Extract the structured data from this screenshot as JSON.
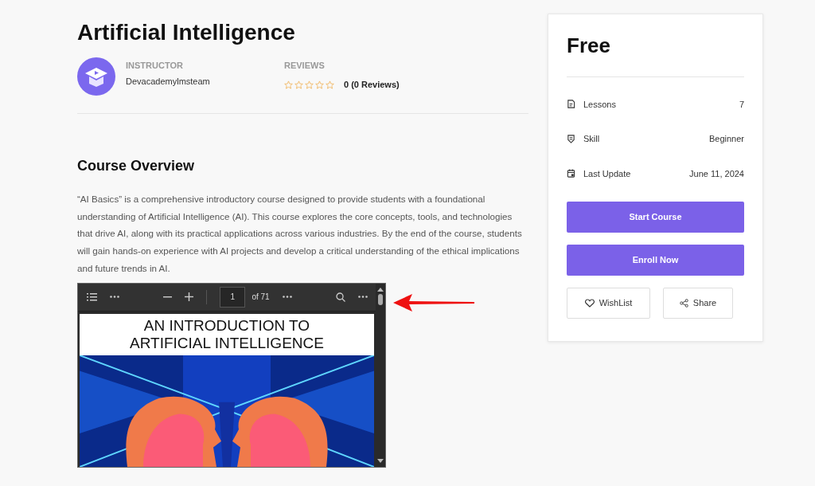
{
  "course": {
    "title": "Artificial Intelligence"
  },
  "instructor": {
    "label": "INSTRUCTOR",
    "name": "Devacademylmsteam"
  },
  "reviews": {
    "label": "REVIEWS",
    "stars": 0,
    "summary": "0 (0 Reviews)"
  },
  "overview": {
    "heading": "Course Overview",
    "text": "“AI Basics” is a comprehensive introductory course designed to provide students with a foundational understanding of Artificial Intelligence (AI). This course explores the core concepts, tools, and technologies that drive AI, along with its practical applications across various industries. By the end of the course, students will gain hands-on experience with AI projects and develop a critical understanding of the ethical implications and future trends in AI."
  },
  "pdf_viewer": {
    "page": "1",
    "page_count": "of 71",
    "document_title": [
      "AN INTRODUCTION TO",
      "ARTIFICIAL INTELLIGENCE"
    ]
  },
  "sidebar": {
    "price": "Free",
    "details": [
      {
        "kind": "lessons",
        "label": "Lessons",
        "value": "7"
      },
      {
        "kind": "skill",
        "label": "Skill",
        "value": "Beginner"
      },
      {
        "kind": "update",
        "label": "Last Update",
        "value": "June 11, 2024"
      }
    ],
    "buttons": [
      {
        "label": "Start Course"
      },
      {
        "label": "Enroll Now"
      }
    ],
    "actions": [
      {
        "kind": "wishlist",
        "label": "WishList"
      },
      {
        "kind": "share",
        "label": "Share"
      }
    ]
  }
}
